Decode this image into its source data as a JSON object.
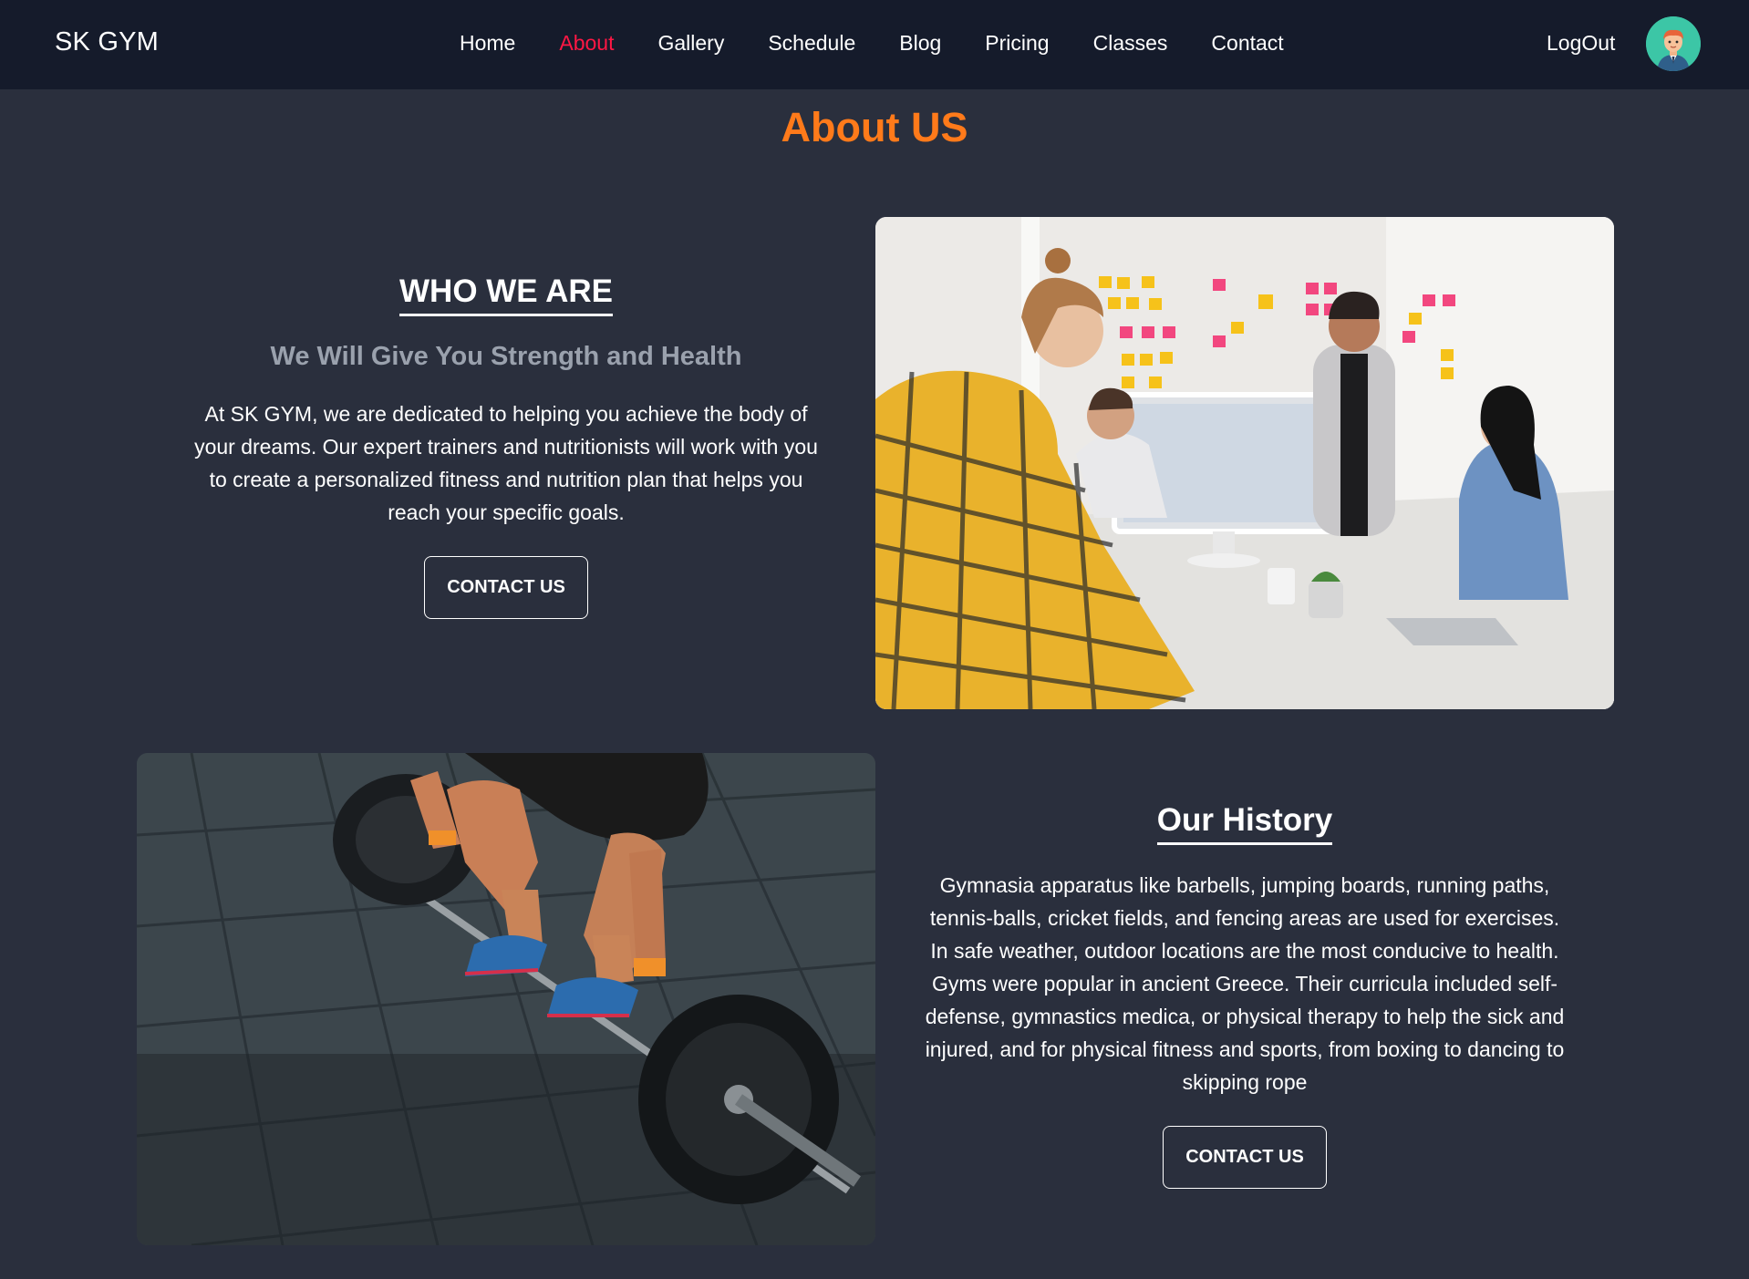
{
  "brand": "SK GYM",
  "nav": {
    "items": [
      {
        "label": "Home",
        "active": false
      },
      {
        "label": "About",
        "active": true
      },
      {
        "label": "Gallery",
        "active": false
      },
      {
        "label": "Schedule",
        "active": false
      },
      {
        "label": "Blog",
        "active": false
      },
      {
        "label": "Pricing",
        "active": false
      },
      {
        "label": "Classes",
        "active": false
      },
      {
        "label": "Contact",
        "active": false
      }
    ],
    "logout_label": "LogOut",
    "avatar_icon": "user-avatar-icon"
  },
  "page_title": "About US",
  "who_we_are": {
    "heading": "WHO WE ARE",
    "subheading": "We Will Give You Strength and Health",
    "text": "At SK GYM, we are dedicated to helping you achieve the body of your dreams. Our expert trainers and nutritionists will work with you to create a personalized fitness and nutrition plan that helps you reach your specific goals.",
    "button_label": "CONTACT US"
  },
  "history": {
    "heading": "Our History",
    "text": "Gymnasia apparatus like barbells, jumping boards, running paths, tennis-balls, cricket fields, and fencing areas are used for exercises. In safe weather, outdoor locations are the most conducive to health. Gyms were popular in ancient Greece. Their curricula included self-defense, gymnastics medica, or physical therapy to help the sick and injured, and for physical fitness and sports, from boxing to dancing to skipping rope",
    "button_label": "CONTACT US"
  },
  "colors": {
    "navbar_bg": "#151b2b",
    "page_bg": "#2a2f3d",
    "active_link": "#ff1744",
    "title_orange": "#ff7a1a",
    "subheading_gray": "#9aa1ad",
    "avatar_bg": "#3cc6a6"
  }
}
